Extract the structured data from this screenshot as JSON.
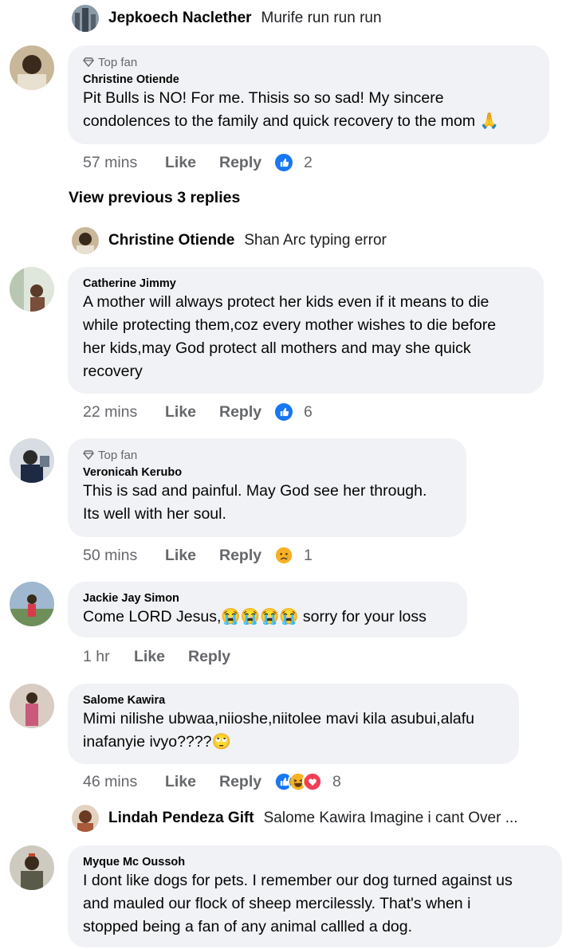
{
  "replies": [
    {
      "name": "Jepkoech Naclether",
      "text": "Murife run run run"
    },
    {
      "name": "Christine Otiende",
      "text": "Shan Arc typing error"
    },
    {
      "name": "Lindah Pendeza Gift",
      "text": "Salome Kawira Imagine i cant Over ..."
    }
  ],
  "view_previous": "View previous 3 replies",
  "labels": {
    "top_fan": "Top fan",
    "like": "Like",
    "reply": "Reply"
  },
  "comments": [
    {
      "author": "Christine Otiende",
      "top_fan": true,
      "lines": [
        "Pit Bulls is NO! For me. Thisis so so sad! My sincere",
        "condolences to the family and quick recovery to the mom 🙏"
      ],
      "time": "57 mins",
      "reaction_count": "2",
      "reactions": [
        "like"
      ]
    },
    {
      "author": "Catherine Jimmy",
      "top_fan": false,
      "lines": [
        "A mother will always protect her kids even if it means to die",
        "while protecting them,coz every mother wishes to die before",
        "her kids,may God protect all mothers and may she quick",
        "recovery"
      ],
      "time": "22 mins",
      "reaction_count": "6",
      "reactions": [
        "like"
      ]
    },
    {
      "author": "Veronicah Kerubo",
      "top_fan": true,
      "lines": [
        "This is sad and painful. May God see her through.",
        "Its well with her soul."
      ],
      "time": "50 mins",
      "reaction_count": "1",
      "reactions": [
        "sad"
      ]
    },
    {
      "author": "Jackie Jay Simon",
      "top_fan": false,
      "lines": [
        "Come LORD Jesus,😭😭😭😭 sorry for your loss"
      ],
      "time": "1 hr",
      "reaction_count": "",
      "reactions": []
    },
    {
      "author": "Salome Kawira",
      "top_fan": false,
      "lines": [
        "Mimi nilishe ubwaa,niioshe,niitolee mavi kila asubui,alafu",
        "inafanyie ivyo????🙄"
      ],
      "time": "46 mins",
      "reaction_count": "8",
      "reactions": [
        "like",
        "haha",
        "love"
      ]
    },
    {
      "author": "Myque Mc Oussoh",
      "top_fan": false,
      "lines": [
        "I dont like dogs for pets. I remember our dog turned against us",
        "and mauled our flock of sheep mercilessly. That's when i",
        "stopped being a fan of any animal callled a dog."
      ],
      "time": "",
      "reaction_count": "",
      "reactions": []
    }
  ],
  "colors": {
    "bubble": "#f0f2f5",
    "meta_text": "#65676b",
    "like_blue": "#1877f2",
    "love_red": "#f33e58",
    "emoji_yellow": "#f7b125"
  }
}
